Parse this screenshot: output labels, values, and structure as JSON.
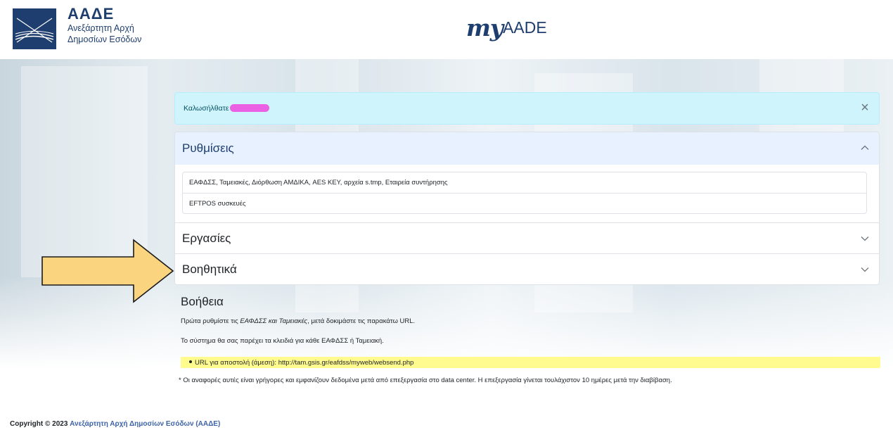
{
  "header": {
    "org_abbr": "ΑΑΔΕ",
    "org_line1": "Ανεξάρτητη Αρχή",
    "org_line2": "Δημοσίων Εσόδων",
    "brand_my": "my",
    "brand_rest": "AADE"
  },
  "alert": {
    "text": "Καλωσήλθατε",
    "close": "×"
  },
  "accordion": {
    "sections": [
      {
        "title": "Ρυθμίσεις",
        "expanded": true
      },
      {
        "title": "Εργασίες",
        "expanded": false
      },
      {
        "title": "Βοηθητικά",
        "expanded": false
      }
    ],
    "items": [
      "ΕΑΦΔΣΣ, Ταμειακές, Διόρθωση ΑΜΔΙΚΑ, AES KEY, αρχεία s.tmp, Εταιρεία συντήρησης",
      "EFTPOS συσκευές"
    ]
  },
  "help": {
    "title": "Βοήθεια",
    "p1_a": "Πρώτα ρυθμίστε τις ",
    "p1_b": "ΕΑΦΔΣΣ και Ταμειακές",
    "p1_c": ", μετά δοκιμάστε τις παρακάτω URL.",
    "p2": "Το σύστημα θα σας παρέχει τα κλειδιά για κάθε ΕΑΦΔΣΣ ή Ταμειακή.",
    "url": "URL για αποστολή (άμεση): http://tam.gsis.gr/eafdss/myweb/websend.php",
    "note": "* Οι αναφορές αυτές είναι γρήγορες και εμφανίζουν δεδομένα μετά από επεξεργασία στο data center. Η επεξεργασία γίνεται τουλάχιστον 10 ημέρες μετά την διαβίβαση."
  },
  "footer": {
    "copyright": "Copyright © 2023",
    "link": "Ανεξάρτητη Αρχή Δημοσίων Εσόδων (ΑΑΔΕ)"
  },
  "colors": {
    "brand_navy": "#1e3e6f",
    "alert_bg": "#cff4fc",
    "accordion_active_bg": "#e7f1ff",
    "url_highlight": "#fffb8f",
    "arrow_fill": "#fbd47f",
    "redaction": "#ea61e3"
  },
  "icons": {
    "logo": "aade-logo-icon",
    "close": "close-icon",
    "chevron_up": "chevron-up-icon",
    "chevron_down": "chevron-down-icon",
    "arrow": "arrow-right-icon"
  }
}
